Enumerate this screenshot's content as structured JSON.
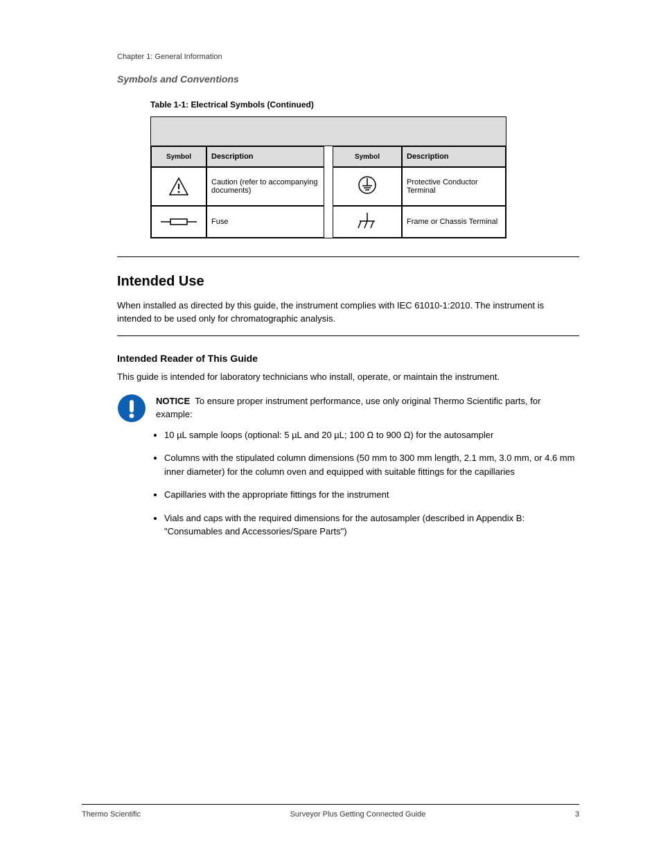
{
  "header": {
    "chapter": "Chapter 1: General Information",
    "section": "Symbols and Conventions"
  },
  "table": {
    "caption": "Table 1-1: Electrical Symbols (Continued)",
    "col_headers": [
      "Symbol",
      "Description",
      "Symbol",
      "Description"
    ],
    "rows": [
      {
        "s1_label": "",
        "d1": "Caution (refer to accompanying documents)",
        "d2": "Protective Conductor Terminal"
      },
      {
        "s1_label": "",
        "d1": "Fuse",
        "d2": "Frame or Chassis Terminal"
      }
    ]
  },
  "section_heading": "Intended Use",
  "intended_use_p1": "When installed as directed by this guide, the instrument complies with IEC 61010-1:2010. The instrument is intended to be used only for chromatographic analysis.",
  "sub_heading": "Intended Reader of This Guide",
  "reader_p1": "This guide is intended for laboratory technicians who install, operate, or maintain the instrument.",
  "notice": {
    "label": "NOTICE",
    "text": "To ensure proper instrument performance, use only original Thermo Scientific parts, for example:",
    "bullets": [
      "Columns with the stipulated column dimensions (50 mm to 300 mm length, 2.1 mm, 3.0 mm, or 4.6 mm inner diameter) for the column oven and equipped with suitable fittings for the capillaries",
      "Capillaries with the appropriate fittings for the instrument",
      "Vials and caps with the required dimensions for the autosampler (described in Appendix B: \"Consumables and Accessories/Spare Parts\")"
    ]
  },
  "bullet_inline": {
    "prefix": "10 µL sample loops (optional: 5 µL and 20 µL; 100  ",
    "omega1": "Ω",
    "mid": " to 900  ",
    "omega2": "Ω",
    "suffix": ") for the autosampler",
    "full_display_fallback": "10 µL sample loops (optional: 5 µL and 20 µL; 100 Ω to 900 Ω) for the autosampler"
  },
  "footer": {
    "left": "Thermo Scientific",
    "center": "Surveyor Plus Getting Connected Guide",
    "right": "3"
  }
}
